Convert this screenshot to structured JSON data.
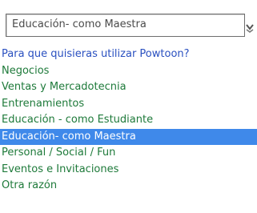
{
  "select": {
    "value": "Educación- como Maestra",
    "arrow_icon": "chevron-down-icon"
  },
  "options": [
    {
      "label": "Para que quisieras utilizar Powtoon?"
    },
    {
      "label": "Negocios"
    },
    {
      "label": "Ventas y Mercadotecnia"
    },
    {
      "label": "Entrenamientos"
    },
    {
      "label": "Educación - como Estudiante"
    },
    {
      "label": "Educación- como Maestra"
    },
    {
      "label": "Personal / Social / Fun"
    },
    {
      "label": "Eventos e Invitaciones"
    },
    {
      "label": "Otra razón"
    }
  ],
  "colors": {
    "selected_bg": "#3f89ea",
    "option_text": "#1e7a3a",
    "placeholder_text": "#2a50c0"
  }
}
